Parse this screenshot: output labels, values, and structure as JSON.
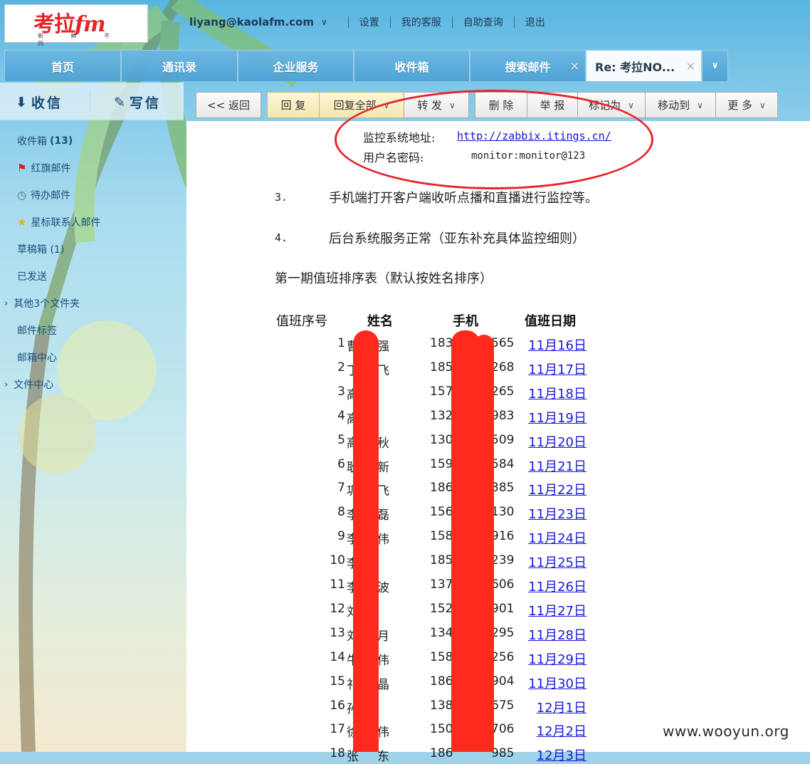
{
  "logo": {
    "brand_text": "考拉FM",
    "brand_main": "考拉",
    "brand_fm": "fm",
    "slogan": "新 鲜 不 同"
  },
  "header": {
    "account": "liyang@kaolafm.com",
    "links": [
      "设置",
      "我的客服",
      "自助查询",
      "退出"
    ]
  },
  "tabs": [
    {
      "label": "首页"
    },
    {
      "label": "通讯录"
    },
    {
      "label": "企业服务"
    },
    {
      "label": "收件箱"
    },
    {
      "label": "搜索邮件",
      "closable": true
    },
    {
      "label": "Re: 考拉NO...",
      "closable": true,
      "active": true
    }
  ],
  "left": {
    "receive": "收信",
    "compose": "写信",
    "folders": {
      "inbox": {
        "label": "收件箱",
        "count": "(13)"
      },
      "flagged": "红旗邮件",
      "todo": "待办邮件",
      "starred": "星标联系人邮件",
      "drafts": "草稿箱 (1)",
      "sent": "已发送",
      "other": "其他3个文件夹",
      "tags": "邮件标签",
      "center": "邮箱中心",
      "files": "文件中心"
    }
  },
  "toolbar": {
    "back": "<< 返回",
    "reply": "回 复",
    "reply_all": "回复全部",
    "forward": "转 发",
    "delete": "删 除",
    "report": "举 报",
    "mark": "标记为",
    "move": "移动到",
    "more": "更 多"
  },
  "message": {
    "monitor_label": "监控系统地址:",
    "monitor_url": "http://zabbix.itings.cn/",
    "cred_label": "用户名密码:",
    "cred_value": "monitor:monitor@123",
    "item3_num": "3.",
    "item3_text": "手机端打开客户端收听点播和直播进行监控等。",
    "item4_num": "4.",
    "item4_text": "后台系统服务正常（亚东补充具体监控细则）",
    "schedule_title": "第一期值班排序表（默认按姓名排序）",
    "columns": [
      "值班序号",
      "姓名",
      "手机",
      "值班日期"
    ]
  },
  "schedule": [
    {
      "no": "1",
      "name_l": "曹",
      "name_r": "强",
      "ph_l": "183",
      "ph_r": "565",
      "date": "11月16日"
    },
    {
      "no": "2",
      "name_l": "丁",
      "name_r": "飞",
      "ph_l": "185",
      "ph_r": "268",
      "date": "11月17日"
    },
    {
      "no": "3",
      "name_l": "高",
      "name_r": "",
      "ph_l": "157",
      "ph_r": "265",
      "date": "11月18日"
    },
    {
      "no": "4",
      "name_l": "高",
      "name_r": "",
      "ph_l": "132",
      "ph_r": "983",
      "date": "11月19日"
    },
    {
      "no": "5",
      "name_l": "高",
      "name_r": "秋",
      "ph_l": "130",
      "ph_r": "509",
      "date": "11月20日"
    },
    {
      "no": "6",
      "name_l": "耿",
      "name_r": "新",
      "ph_l": "159",
      "ph_r": "584",
      "date": "11月21日"
    },
    {
      "no": "7",
      "name_l": "巩",
      "name_r": "飞",
      "ph_l": "186",
      "ph_r": "385",
      "date": "11月22日"
    },
    {
      "no": "8",
      "name_l": "李",
      "name_r": "磊",
      "ph_l": "156",
      "ph_r": "130",
      "date": "11月23日"
    },
    {
      "no": "9",
      "name_l": "李",
      "name_r": "伟",
      "ph_l": "158",
      "ph_r": "916",
      "date": "11月24日"
    },
    {
      "no": "10",
      "name_l": "李",
      "name_r": "",
      "ph_l": "185",
      "ph_r": "239",
      "date": "11月25日"
    },
    {
      "no": "11",
      "name_l": "李",
      "name_r": "波",
      "ph_l": "137",
      "ph_r": "606",
      "date": "11月26日"
    },
    {
      "no": "12",
      "name_l": "刘",
      "name_r": "",
      "ph_l": "152",
      "ph_r": "901",
      "date": "11月27日"
    },
    {
      "no": "13",
      "name_l": "刘",
      "name_r": "月",
      "ph_l": "134",
      "ph_r": "295",
      "date": "11月28日"
    },
    {
      "no": "14",
      "name_l": "牛",
      "name_r": "伟",
      "ph_l": "158",
      "ph_r": "256",
      "date": "11月29日"
    },
    {
      "no": "15",
      "name_l": "祁",
      "name_r": "晶",
      "ph_l": "186",
      "ph_r": "904",
      "date": "11月30日"
    },
    {
      "no": "16",
      "name_l": "孙",
      "name_r": "",
      "ph_l": "138",
      "ph_r": "675",
      "date": "12月1日"
    },
    {
      "no": "17",
      "name_l": "徐",
      "name_r": "伟",
      "ph_l": "150",
      "ph_r": "706",
      "date": "12月2日"
    },
    {
      "no": "18",
      "name_l": "张",
      "name_r": "东",
      "ph_l": "186",
      "ph_r": "985",
      "date": "12月3日"
    }
  ],
  "watermark": "www.wooyun.org"
}
